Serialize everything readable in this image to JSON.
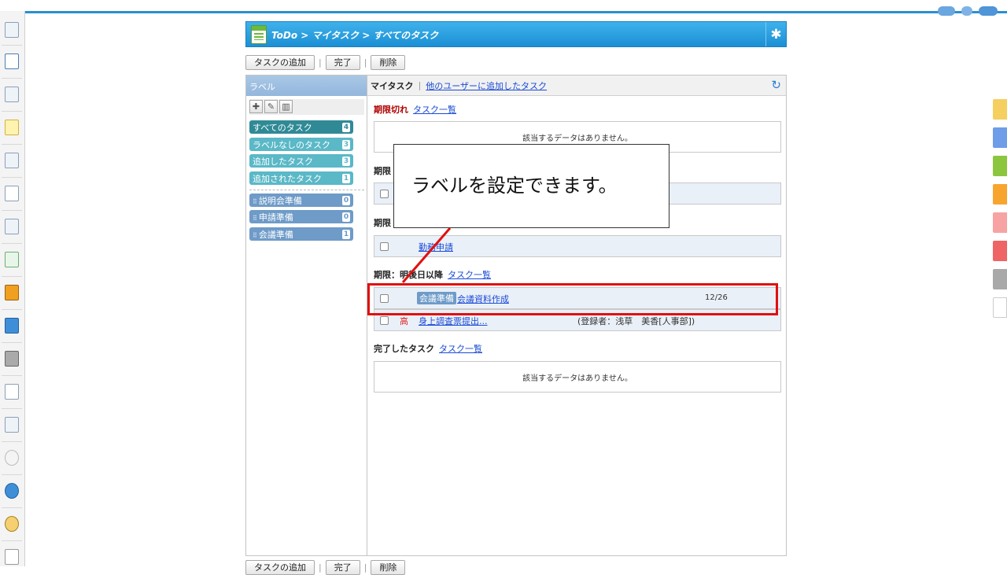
{
  "header": {
    "breadcrumb": "ToDo > マイタスク > すべてのタスク"
  },
  "toolbar": {
    "add_task": "タスクの追加",
    "complete": "完了",
    "delete": "削除",
    "separator": "|"
  },
  "label_pane": {
    "heading": "ラベル",
    "tools": [
      "add-icon",
      "edit-icon",
      "trash-icon"
    ],
    "system_labels": [
      {
        "name": "すべてのタスク",
        "count": "4",
        "color": "#2f8a96"
      },
      {
        "name": "ラベルなしのタスク",
        "count": "3",
        "color": "#5ab8c7"
      },
      {
        "name": "追加したタスク",
        "count": "3",
        "color": "#5ab8c7"
      },
      {
        "name": "追加されたタスク",
        "count": "1",
        "color": "#5ab8c7"
      }
    ],
    "user_labels": [
      {
        "name": "説明会準備",
        "count": "0",
        "color": "#6e9bc8"
      },
      {
        "name": "申請準備",
        "count": "0",
        "color": "#6e9bc8"
      },
      {
        "name": "会議準備",
        "count": "1",
        "color": "#6e9bc8"
      }
    ]
  },
  "main": {
    "tab_current": "マイタスク",
    "tab_other": "他のユーザーに追加したタスク",
    "tab_separator": "|",
    "sections": {
      "overdue": {
        "title": "期限切れ",
        "link": "タスク一覧",
        "empty": "該当するデータはありません。"
      },
      "today": {
        "title": "期限"
      },
      "tomorrow": {
        "title": "期限",
        "task_link": "勤務申請"
      },
      "later": {
        "title": "期限：明後日以降",
        "link": "タスク一覧",
        "tasks": [
          {
            "label": "会議準備",
            "name": "会議資料作成",
            "due": "12/26"
          },
          {
            "priority": "高",
            "name": "身上調査票提出...",
            "registrant": "(登録者：浅草　美香[人事部])"
          }
        ]
      },
      "completed": {
        "title": "完了したタスク",
        "link": "タスク一覧",
        "empty": "該当するデータはありません。"
      }
    }
  },
  "callout": {
    "text": "ラベルを設定できます。"
  },
  "colors": {
    "accent": "#1b8fd4",
    "highlight": "#e01010",
    "overdue_title": "#b00000"
  }
}
